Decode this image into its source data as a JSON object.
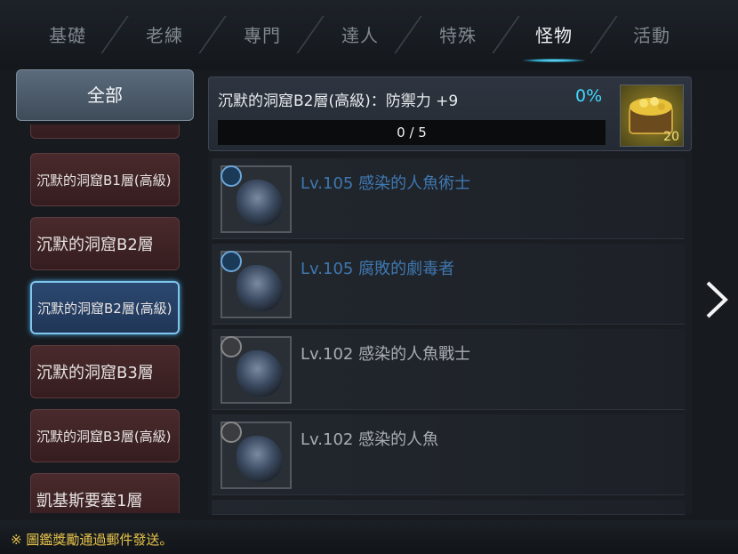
{
  "tabs": [
    {
      "label": "基礎"
    },
    {
      "label": "老練"
    },
    {
      "label": "專門"
    },
    {
      "label": "達人"
    },
    {
      "label": "特殊"
    },
    {
      "label": "怪物",
      "active": true
    },
    {
      "label": "活動"
    }
  ],
  "sidebar": {
    "all_label": "全部",
    "items": [
      {
        "label": ""
      },
      {
        "label": "沉默的洞窟B1層(高級)"
      },
      {
        "label": "沉默的洞窟B2層"
      },
      {
        "label": "沉默的洞窟B2層(高級)",
        "selected": true
      },
      {
        "label": "沉默的洞窟B3層"
      },
      {
        "label": "沉默的洞窟B3層(高級)"
      },
      {
        "label": "凱基斯要塞1層"
      }
    ]
  },
  "achievement": {
    "title": "沉默的洞窟B2層(高級)：防禦力 +9",
    "percent": "0%",
    "progress": "0 / 5",
    "progress_fraction": 0,
    "reward_count": "20",
    "reward_icon": "gold-chest-icon"
  },
  "monsters": [
    {
      "name": "Lv.105 感染的人魚術士",
      "status": "blue"
    },
    {
      "name": "Lv.105 腐敗的劇毒者",
      "status": "blue"
    },
    {
      "name": "Lv.102 感染的人魚戰士",
      "status": "grey"
    },
    {
      "name": "Lv.102 感染的人魚",
      "status": "grey"
    }
  ],
  "footer": {
    "note": "※ 圖鑑獎勵通過郵件發送。"
  },
  "colors": {
    "accent": "#40d8ff",
    "footer": "#e6c24a",
    "selected_border": "#7fc6ef"
  }
}
